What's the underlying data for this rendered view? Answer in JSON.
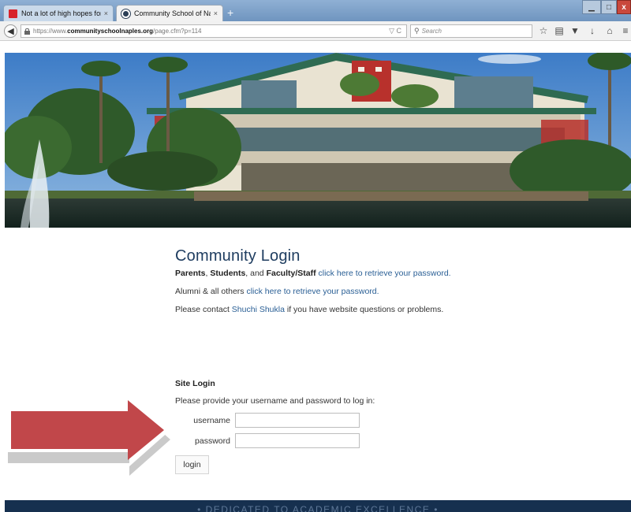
{
  "browser": {
    "tabs": [
      {
        "label": "Not a lot of high hopes for ...",
        "close": "×"
      },
      {
        "label": "Community School of Nap...",
        "close": "×"
      }
    ],
    "new_tab": "+",
    "url": {
      "prefix": "https://www.",
      "host": "communityschoolnaples.org",
      "path": "/page.cfm?p=114",
      "controls": "▽ C"
    },
    "search_placeholder": "Search",
    "window_controls": {
      "minimize": "▁",
      "maximize": "□",
      "close": "x"
    }
  },
  "content": {
    "title": "Community Login",
    "line1": {
      "b1": "Parents",
      "t1": ", ",
      "b2": "Students",
      "t2": ", and ",
      "b3": "Faculty/Staff",
      "t3": " ",
      "link": "click here to retrieve your password."
    },
    "line2": {
      "text": "Alumni & all others ",
      "link": "click here to retrieve your password."
    },
    "line3": {
      "pre": "Please contact ",
      "link": "Shuchi Shukla",
      "post": " if you have website questions or problems."
    }
  },
  "site_login": {
    "heading": "Site Login",
    "prompt": "Please provide your username and password to log in:",
    "username_label": "username",
    "password_label": "password",
    "button": "login"
  },
  "footer": {
    "text": "•   DEDICATED TO ACADEMIC EXCELLENCE   •"
  },
  "colors": {
    "title": "#1f3d60",
    "link": "#2a5f95",
    "footer_bg": "#16304f",
    "arrow": "#c1474a"
  }
}
